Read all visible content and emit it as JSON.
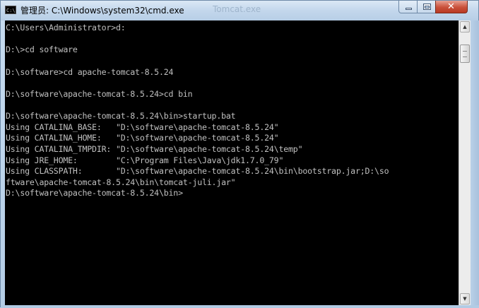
{
  "window": {
    "title": "管理员: C:\\Windows\\system32\\cmd.exe",
    "ghost_title": "Tomcat.exe",
    "icon_text": "C:\\",
    "controls": {
      "minimize_icon": "minimize-icon",
      "maximize_icon": "maximize-icon",
      "close_icon": "close-icon",
      "close_glyph": "✕"
    }
  },
  "console": {
    "background": "#000000",
    "foreground": "#c0c0c0",
    "lines": [
      "C:\\Users\\Administrator>d:",
      "",
      "D:\\>cd software",
      "",
      "D:\\software>cd apache-tomcat-8.5.24",
      "",
      "D:\\software\\apache-tomcat-8.5.24>cd bin",
      "",
      "D:\\software\\apache-tomcat-8.5.24\\bin>startup.bat",
      "Using CATALINA_BASE:   \"D:\\software\\apache-tomcat-8.5.24\"",
      "Using CATALINA_HOME:   \"D:\\software\\apache-tomcat-8.5.24\"",
      "Using CATALINA_TMPDIR: \"D:\\software\\apache-tomcat-8.5.24\\temp\"",
      "Using JRE_HOME:        \"C:\\Program Files\\Java\\jdk1.7.0_79\"",
      "Using CLASSPATH:       \"D:\\software\\apache-tomcat-8.5.24\\bin\\bootstrap.jar;D:\\so",
      "ftware\\apache-tomcat-8.5.24\\bin\\tomcat-juli.jar\"",
      "D:\\software\\apache-tomcat-8.5.24\\bin>"
    ]
  },
  "scrollbar": {
    "up_glyph": "▲",
    "down_glyph": "▼",
    "position": 0.05
  }
}
